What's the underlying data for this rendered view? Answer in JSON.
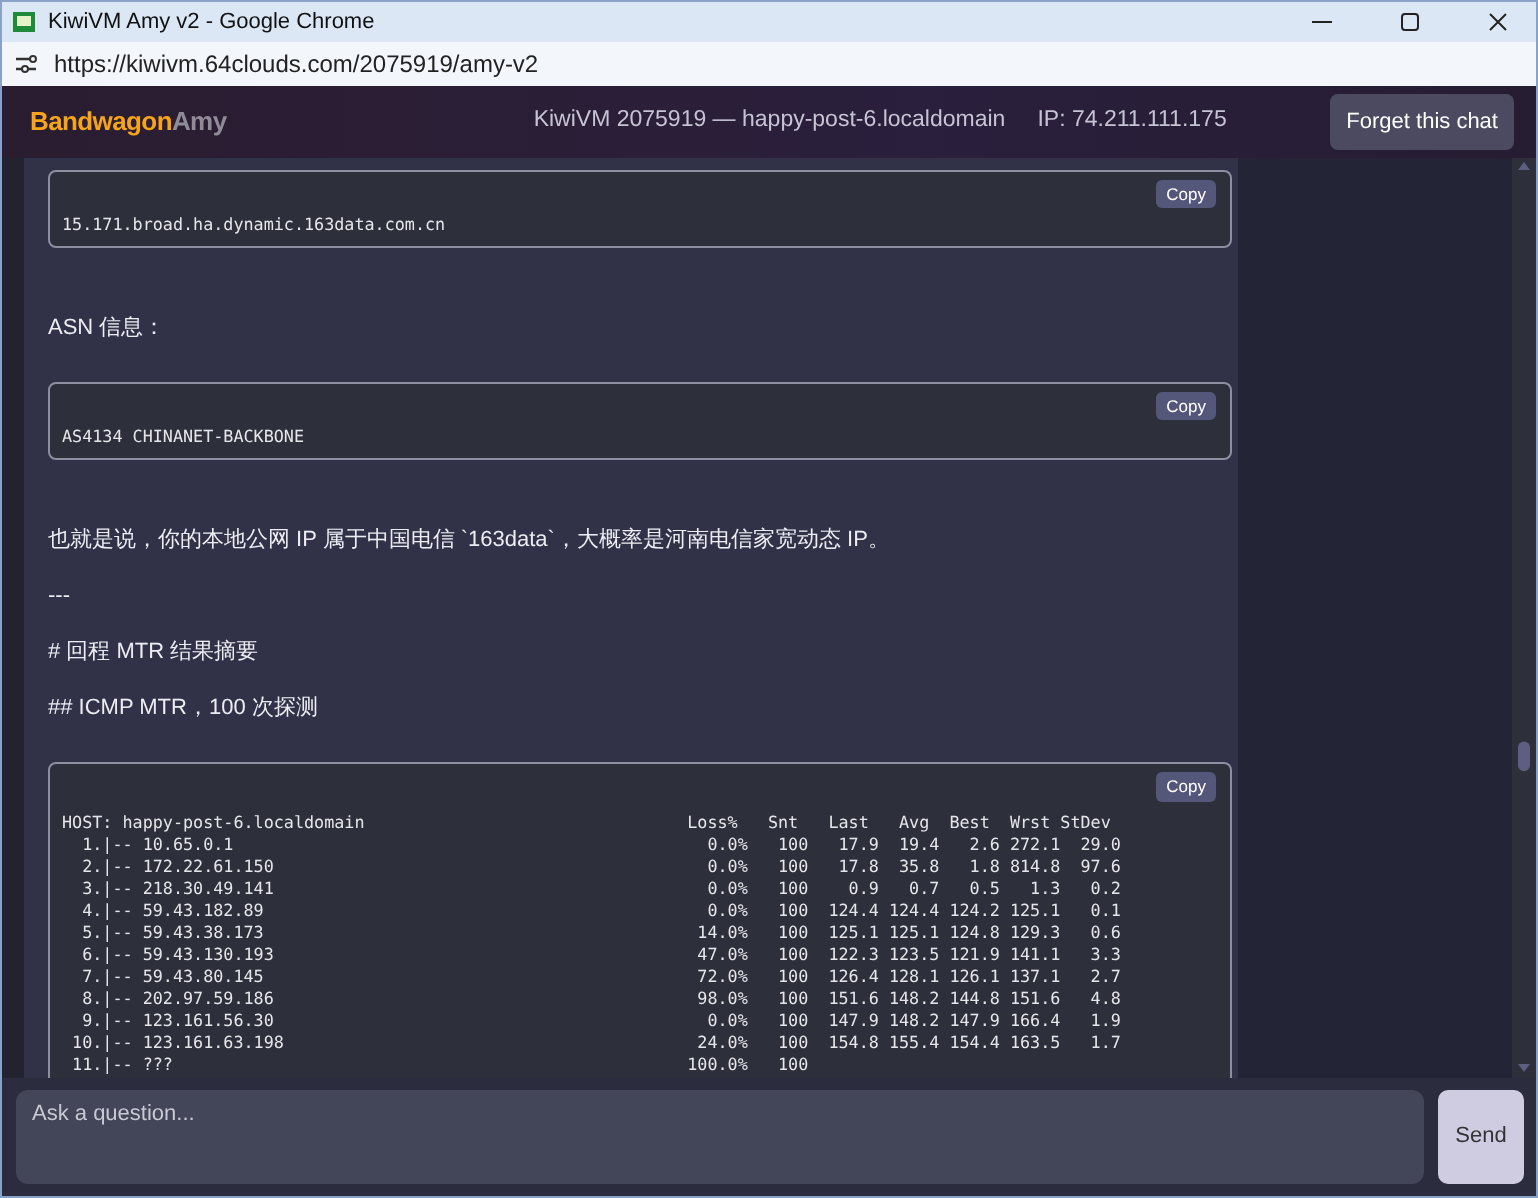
{
  "window": {
    "title": "KiwiVM Amy v2 - Google Chrome"
  },
  "address_bar": {
    "url": "https://kiwivm.64clouds.com/2075919/amy-v2"
  },
  "header": {
    "logo": [
      "Bandwagon",
      "Amy"
    ],
    "server": "KiwiVM 2075919 — happy-post-6.localdomain",
    "ip": "IP: 74.211.111.175",
    "button": "Forget this chat"
  },
  "messages": [
    {
      "kind": "code",
      "copy": "Copy",
      "lines": [
        "15.171.broad.ha.dynamic.163data.com.cn"
      ]
    },
    {
      "kind": "text",
      "text": "ASN 信息："
    },
    {
      "kind": "code",
      "copy": "Copy",
      "lines": [
        "AS4134 CHINANET-BACKBONE"
      ]
    },
    {
      "kind": "text",
      "text": "也就是说，你的本地公网 IP 属于中国电信 `163data`，大概率是河南电信家宽动态 IP。"
    },
    {
      "kind": "text",
      "text": "---"
    },
    {
      "kind": "text",
      "text": "# 回程 MTR 结果摘要"
    },
    {
      "kind": "text",
      "text": "## ICMP MTR，100 次探测"
    },
    {
      "kind": "code",
      "copy": "Copy",
      "lines": [
        "HOST: happy-post-6.localdomain                                Loss%   Snt   Last   Avg  Best  Wrst StDev",
        "  1.|-- 10.65.0.1                                               0.0%   100   17.9  19.4   2.6 272.1  29.0",
        "  2.|-- 172.22.61.150                                           0.0%   100   17.8  35.8   1.8 814.8  97.6",
        "  3.|-- 218.30.49.141                                           0.0%   100    0.9   0.7   0.5   1.3   0.2",
        "  4.|-- 59.43.182.89                                            0.0%   100  124.4 124.4 124.2 125.1   0.1",
        "  5.|-- 59.43.38.173                                           14.0%   100  125.1 125.1 124.8 129.3   0.6",
        "  6.|-- 59.43.130.193                                          47.0%   100  122.3 123.5 121.9 141.1   3.3",
        "  7.|-- 59.43.80.145                                           72.0%   100  126.4 128.1 126.1 137.1   2.7",
        "  8.|-- 202.97.59.186                                          98.0%   100  151.6 148.2 144.8 151.6   4.8",
        "  9.|-- 123.161.56.30                                           0.0%   100  147.9 148.2 147.9 166.4   1.9",
        " 10.|-- 123.161.63.198                                         24.0%   100  154.8 155.4 154.4 163.5   1.7",
        " 11.|-- ???                                                   100.0%   100"
      ]
    }
  ],
  "composer": {
    "placeholder": "Ask a question...",
    "button": "Send"
  }
}
